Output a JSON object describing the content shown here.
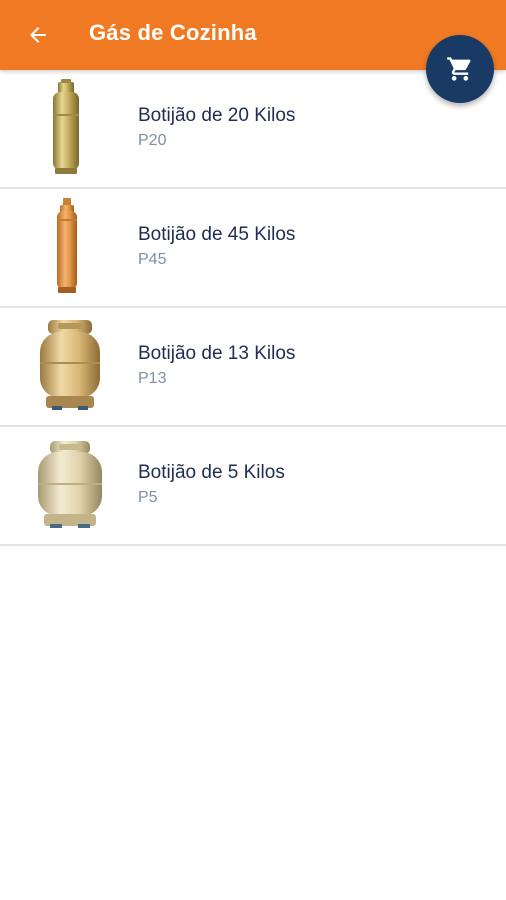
{
  "appbar": {
    "title": "Gás de Cozinha",
    "back_icon": "arrow-left-icon",
    "cart_icon": "shopping-cart-icon",
    "color": "#f07a24",
    "fab_color": "#1a3a66"
  },
  "products": [
    {
      "name": "Botijão de 20 Kilos",
      "code": "P20",
      "icon": "gas-cylinder-tall-icon"
    },
    {
      "name": "Botijão de 45 Kilos",
      "code": "P45",
      "icon": "gas-cylinder-slim-icon"
    },
    {
      "name": "Botijão de 13 Kilos",
      "code": "P13",
      "icon": "gas-cylinder-round-icon"
    },
    {
      "name": "Botijão de 5 Kilos",
      "code": "P5",
      "icon": "gas-cylinder-small-icon"
    }
  ]
}
